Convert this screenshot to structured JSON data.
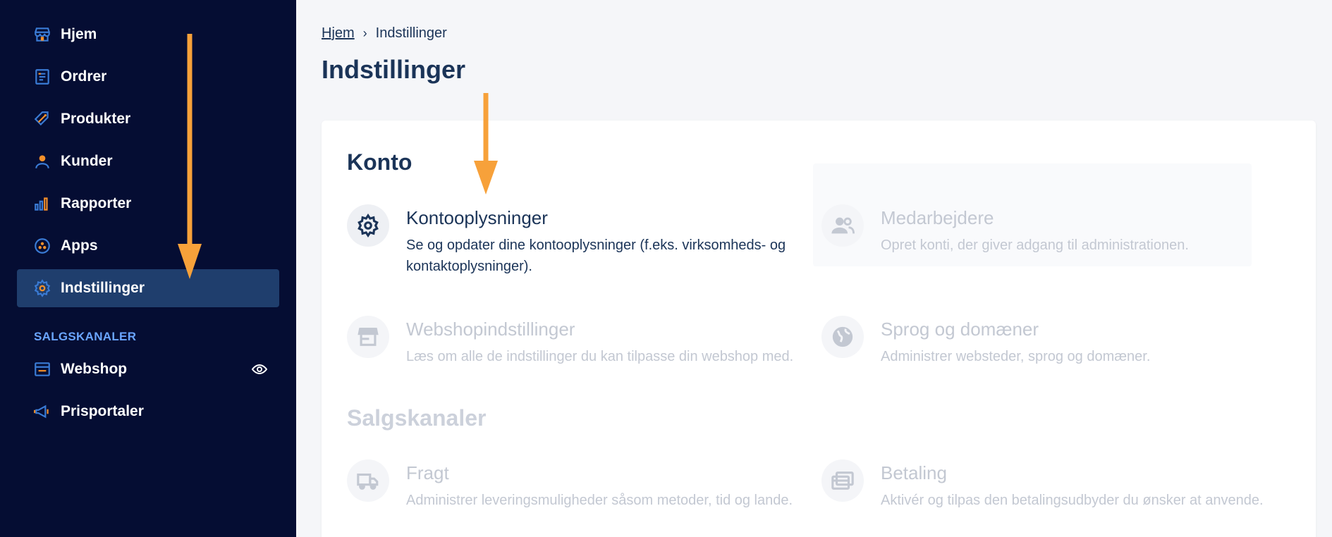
{
  "sidebar": {
    "items": [
      {
        "label": "Hjem",
        "icon": "store-icon"
      },
      {
        "label": "Ordrer",
        "icon": "orders-icon"
      },
      {
        "label": "Produkter",
        "icon": "tag-icon"
      },
      {
        "label": "Kunder",
        "icon": "user-icon"
      },
      {
        "label": "Rapporter",
        "icon": "chart-icon"
      },
      {
        "label": "Apps",
        "icon": "apps-icon"
      },
      {
        "label": "Indstillinger",
        "icon": "gear-icon",
        "active": true
      }
    ],
    "section_label": "SALGSKANALER",
    "channels": [
      {
        "label": "Webshop",
        "icon": "browser-icon"
      },
      {
        "label": "Prisportaler",
        "icon": "megaphone-icon"
      }
    ]
  },
  "breadcrumb": {
    "home": "Hjem",
    "current": "Indstillinger"
  },
  "page_title": "Indstillinger",
  "sections": {
    "konto": {
      "title": "Konto",
      "items": [
        {
          "title": "Kontooplysninger",
          "desc": "Se og opdater dine kontooplysninger (f.eks. virksomheds- og kontaktoplysninger).",
          "icon": "gear-icon"
        },
        {
          "title": "Medarbejdere",
          "desc": "Opret konti, der giver adgang til administrationen.",
          "icon": "users-icon"
        },
        {
          "title": "Webshopindstillinger",
          "desc": "Læs om alle de indstillinger du kan tilpasse din webshop med.",
          "icon": "storefront-icon"
        },
        {
          "title": "Sprog og domæner",
          "desc": "Administrer websteder, sprog og domæner.",
          "icon": "globe-icon"
        }
      ]
    },
    "salgskanaler": {
      "title": "Salgskanaler",
      "items": [
        {
          "title": "Fragt",
          "desc": "Administrer leveringsmuligheder såsom metoder, tid og lande.",
          "icon": "truck-icon"
        },
        {
          "title": "Betaling",
          "desc": "Aktivér og tilpas den betalingsudbyder du ønsker at anvende.",
          "icon": "card-icon"
        }
      ]
    }
  },
  "colors": {
    "sidebar_bg": "#050d33",
    "active_bg": "#1f3e6d",
    "accent_blue": "#3a7bd5",
    "accent_orange": "#f5902a",
    "arrow": "#f7a13a",
    "text_dark": "#1b3458"
  }
}
